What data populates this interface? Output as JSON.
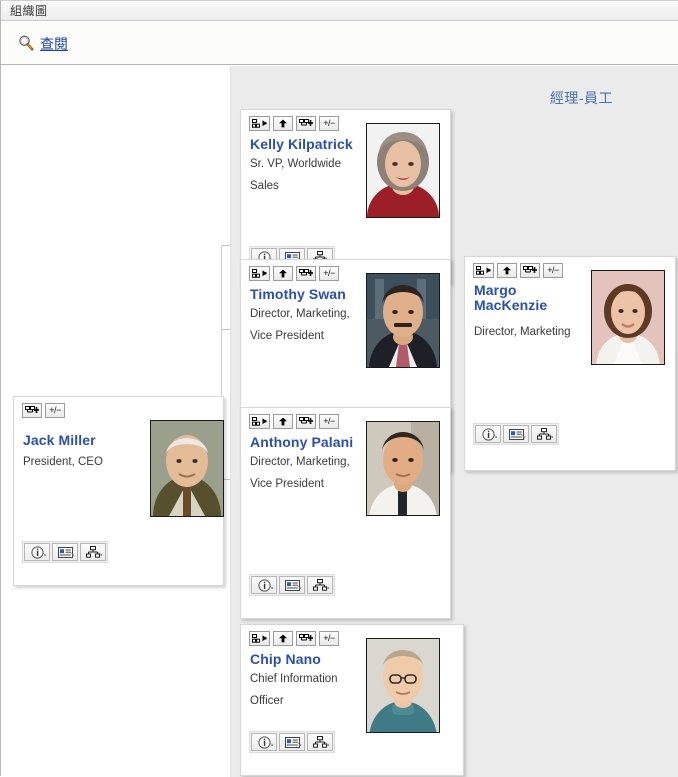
{
  "window": {
    "title": "組織圖"
  },
  "toolbar": {
    "view_label": "查閱",
    "search_icon": "magnifier-icon"
  },
  "chart": {
    "relationship_label": "經理-員工",
    "panel_background": "#ebebeb",
    "name_color": "#2b4fae",
    "heading_color": "#4a6fae"
  },
  "buttons": {
    "top": [
      {
        "name": "go-to-manager-button",
        "icon": "org-node-left-arrow-icon",
        "title": ""
      },
      {
        "name": "move-up-button",
        "icon": "up-arrow-icon",
        "title": ""
      },
      {
        "name": "add-node-button",
        "icon": "org-node-plus-icon",
        "title": ""
      },
      {
        "name": "expand-collapse-button",
        "icon": "plus-minus-icon",
        "label": "+/−"
      }
    ],
    "root_top": [
      {
        "name": "add-node-button",
        "icon": "org-node-plus-icon",
        "title": ""
      },
      {
        "name": "expand-collapse-button",
        "icon": "plus-minus-icon",
        "label": "+/−"
      }
    ],
    "bottom": [
      {
        "name": "details-button",
        "icon": "info-circle-icon"
      },
      {
        "name": "business-card-button",
        "icon": "vcard-icon"
      },
      {
        "name": "org-chart-button",
        "icon": "org-chart-icon"
      }
    ]
  },
  "nodes": [
    {
      "id": "jack-miller",
      "name": "Jack Miller",
      "title_lines": [
        "President, CEO"
      ],
      "photo": "portrait-older-man-suit",
      "is_root": true
    },
    {
      "id": "kelly-kilpatrick",
      "name": "Kelly Kilpatrick",
      "title_lines": [
        "Sr. VP, Worldwide",
        "Sales"
      ],
      "photo": "portrait-woman-red-top",
      "is_root": false
    },
    {
      "id": "timothy-swan",
      "name": "Timothy Swan",
      "title_lines": [
        "Director, Marketing,",
        "Vice President"
      ],
      "photo": "portrait-man-mustache-suit",
      "is_root": false
    },
    {
      "id": "margo-mackenzie",
      "name": "Margo MacKenzie",
      "title_lines": [
        "Director, Marketing"
      ],
      "photo": "portrait-woman-white-blouse",
      "is_root": false
    },
    {
      "id": "anthony-palani",
      "name": "Anthony Palani",
      "title_lines": [
        "Director, Marketing,",
        "Vice President"
      ],
      "photo": "portrait-man-white-shirt-tie",
      "is_root": false
    },
    {
      "id": "chip-nano",
      "name": "Chip Nano",
      "title_lines": [
        "Chief Information",
        "Officer"
      ],
      "photo": "portrait-man-glasses-turtleneck",
      "is_root": false
    }
  ]
}
